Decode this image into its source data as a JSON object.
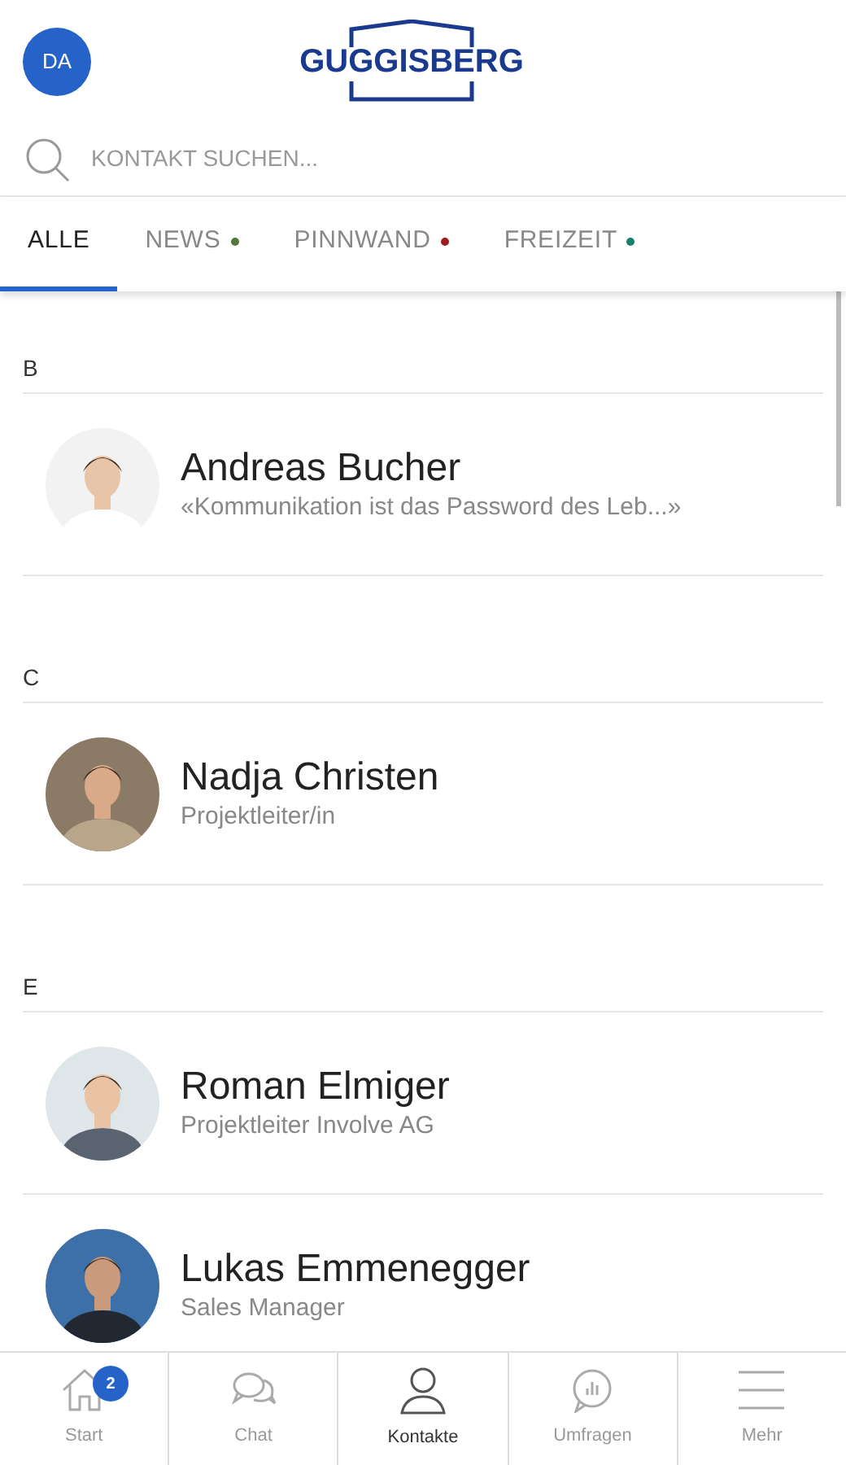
{
  "header": {
    "avatar_initials": "DA",
    "logo_text": "GUGGISBERG"
  },
  "search": {
    "placeholder": "KONTAKT SUCHEN..."
  },
  "tabs": [
    {
      "label": "ALLE",
      "selected": true
    },
    {
      "label": "NEWS",
      "selected": false,
      "color": "#4f7a3a"
    },
    {
      "label": "PINNWAND",
      "selected": false,
      "color": "#a11d1d"
    },
    {
      "label": "FREIZEIT",
      "selected": false,
      "color": "#17806a"
    }
  ],
  "sections": [
    {
      "letter": "B",
      "contacts": [
        {
          "name": "Andreas Bucher",
          "subtitle": "«Kommunikation ist das Password des Leb...»"
        }
      ]
    },
    {
      "letter": "C",
      "contacts": [
        {
          "name": "Nadja Christen",
          "subtitle": "Projektleiter/in"
        }
      ]
    },
    {
      "letter": "E",
      "contacts": [
        {
          "name": "Roman Elmiger",
          "subtitle": "Projektleiter Involve AG"
        },
        {
          "name": "Lukas Emmenegger",
          "subtitle": "Sales Manager"
        }
      ]
    }
  ],
  "bottom_nav": [
    {
      "kind": "home",
      "label": "Start",
      "selected": false,
      "badge": "2"
    },
    {
      "kind": "chat",
      "label": "Chat",
      "selected": false
    },
    {
      "kind": "person",
      "label": "Kontakte",
      "selected": true
    },
    {
      "kind": "poll",
      "label": "Umfragen",
      "selected": false
    },
    {
      "kind": "menu",
      "label": "Mehr",
      "selected": false
    }
  ]
}
